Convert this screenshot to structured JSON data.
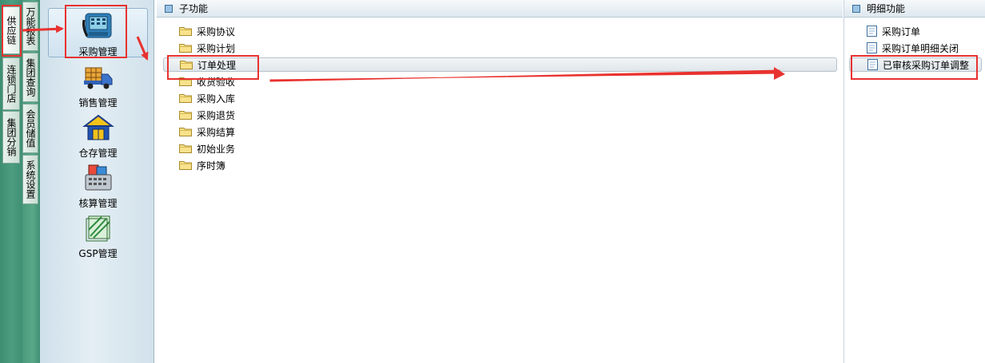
{
  "left_tabs_outer": [
    {
      "label": "供应链",
      "active": true
    },
    {
      "label": "连锁门店",
      "active": false
    },
    {
      "label": "集团分销",
      "active": false
    }
  ],
  "left_tabs_inner": [
    {
      "label": "万能报表"
    },
    {
      "label": "集团查询"
    },
    {
      "label": "会员储值"
    },
    {
      "label": "系统设置"
    }
  ],
  "modules": [
    {
      "label": "采购管理",
      "icon": "purchase-phone-icon",
      "selected": true
    },
    {
      "label": "销售管理",
      "icon": "sales-truck-icon",
      "selected": false
    },
    {
      "label": "仓存管理",
      "icon": "warehouse-house-icon",
      "selected": false
    },
    {
      "label": "核算管理",
      "icon": "accounting-calculator-icon",
      "selected": false
    },
    {
      "label": "GSP管理",
      "icon": "gsp-document-icon",
      "selected": false
    }
  ],
  "sub_panel": {
    "title": "子功能",
    "items": [
      {
        "label": "采购协议",
        "selected": false
      },
      {
        "label": "采购计划",
        "selected": false
      },
      {
        "label": "订单处理",
        "selected": true
      },
      {
        "label": "收货验收",
        "selected": false
      },
      {
        "label": "采购入库",
        "selected": false
      },
      {
        "label": "采购退货",
        "selected": false
      },
      {
        "label": "采购结算",
        "selected": false
      },
      {
        "label": "初始业务",
        "selected": false
      },
      {
        "label": "序时簿",
        "selected": false
      }
    ]
  },
  "detail_panel": {
    "title": "明细功能",
    "items": [
      {
        "label": "采购订单",
        "selected": false
      },
      {
        "label": "采购订单明细关闭",
        "selected": false
      },
      {
        "label": "已审核采购订单调整",
        "selected": true
      }
    ]
  },
  "colors": {
    "annotation": "#e8322f",
    "sidebar_green": "#4d9e80",
    "module_panel": "#dde9f0"
  }
}
